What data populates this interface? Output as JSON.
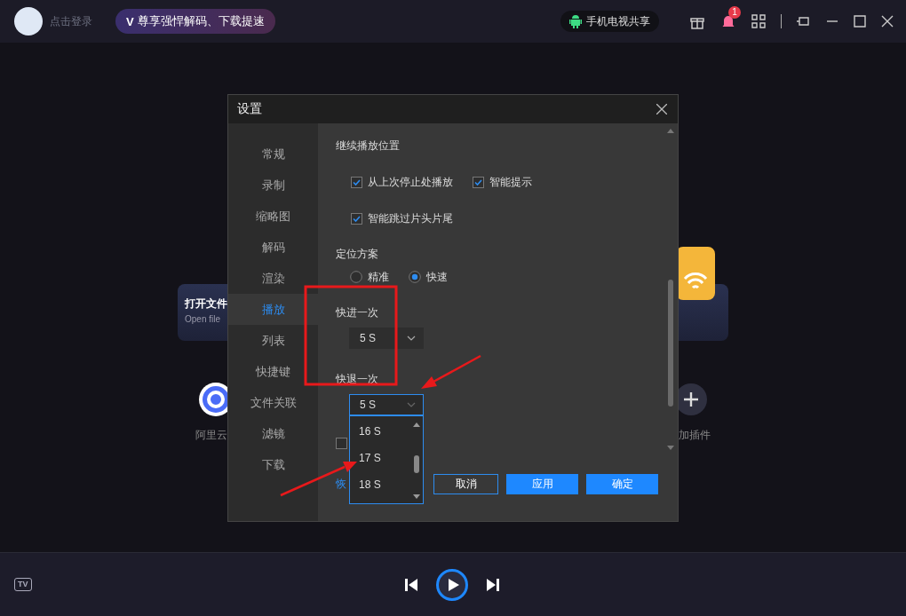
{
  "topbar": {
    "login": "点击登录",
    "promo_badge": "V",
    "promo": "尊享强悍解码、下载提速",
    "share": "手机电视共享",
    "notification_count": "1"
  },
  "background": {
    "open_file_title": "打开文件",
    "open_file_subtitle": "Open file",
    "cloud_label": "阿里云",
    "plugin_label": "加插件"
  },
  "dialog": {
    "title": "设置",
    "nav": [
      {
        "label": "常规",
        "selected": false
      },
      {
        "label": "录制",
        "selected": false
      },
      {
        "label": "缩略图",
        "selected": false
      },
      {
        "label": "解码",
        "selected": false
      },
      {
        "label": "渲染",
        "selected": false
      },
      {
        "label": "播放",
        "selected": true
      },
      {
        "label": "列表",
        "selected": false
      },
      {
        "label": "快捷键",
        "selected": false
      },
      {
        "label": "文件关联",
        "selected": false
      },
      {
        "label": "滤镜",
        "selected": false
      },
      {
        "label": "下载",
        "selected": false
      }
    ],
    "content": [
      {
        "kind": "heading",
        "text": "继续播放位置"
      },
      {
        "kind": "checks",
        "items": [
          {
            "label": "从上次停止处播放",
            "checked": true
          },
          {
            "label": "智能提示",
            "checked": true
          }
        ]
      },
      {
        "kind": "checks",
        "items": [
          {
            "label": "智能跳过片头片尾",
            "checked": true
          }
        ]
      },
      {
        "kind": "heading",
        "text": "定位方案"
      },
      {
        "kind": "radios",
        "items": [
          {
            "label": "精准",
            "selected": false
          },
          {
            "label": "快速",
            "selected": true
          }
        ]
      },
      {
        "kind": "heading",
        "text": "快进一次"
      },
      {
        "kind": "select",
        "value": "5 S",
        "expanded": false
      },
      {
        "kind": "heading",
        "text": "快退一次"
      },
      {
        "kind": "select",
        "value": "5 S",
        "expanded": true,
        "options": [
          "16 S",
          "17 S",
          "18 S"
        ]
      },
      {
        "kind": "bare_checkbox",
        "checked": false
      }
    ],
    "reset_link": "恢",
    "buttons": [
      {
        "label": "取消",
        "primary": false
      },
      {
        "label": "应用",
        "primary": true
      },
      {
        "label": "确定",
        "primary": true
      }
    ]
  },
  "bottom": {
    "tv_label": "TV"
  }
}
